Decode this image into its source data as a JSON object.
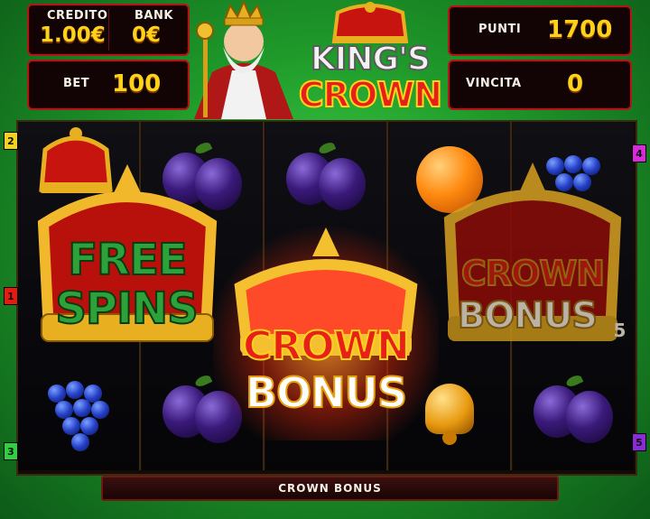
{
  "hud": {
    "credito_label": "CREDITO",
    "credito_value": "1.00€",
    "bank_label": "BANK",
    "bank_value": "0€",
    "bet_label": "BET",
    "bet_value": "100",
    "punti_label": "PUNTI",
    "punti_value": "1700",
    "vincita_label": "VINCITA",
    "vincita_value": "0"
  },
  "logo": {
    "line1": "KING'S",
    "line2": "CROWN"
  },
  "line_markers": {
    "left": [
      "2",
      "1",
      "3"
    ],
    "right": [
      "4",
      "5"
    ]
  },
  "overlays": {
    "free_spins_1": "FREE",
    "free_spins_2": "SPINS",
    "crown_bonus_center_1": "CROWN",
    "crown_bonus_center_2": "BONUS",
    "crown_bonus_right_1": "CROWN",
    "crown_bonus_right_2": "BONUS",
    "crown_bonus_right_count": "5"
  },
  "status_bar": "CROWN BONUS",
  "colors": {
    "accent": "#ffd21a",
    "panel_border": "#b01818",
    "free_spins": "#2ea23a",
    "bonus_red": "#e8201a"
  }
}
